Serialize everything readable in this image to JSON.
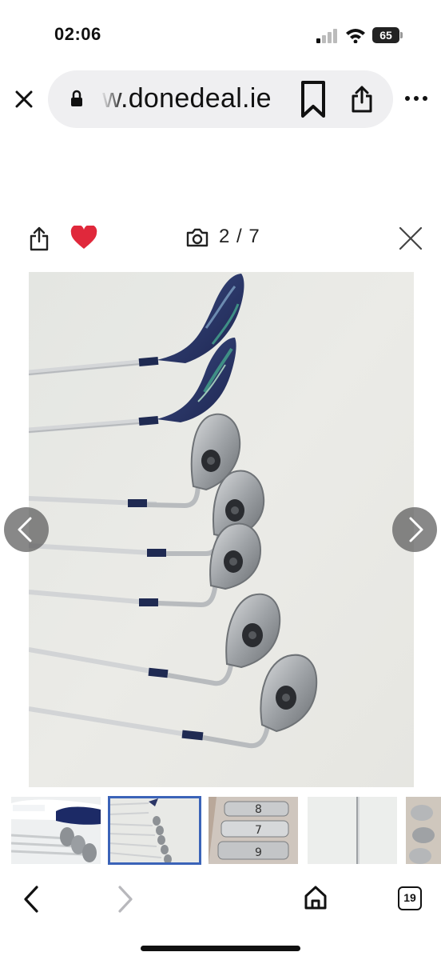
{
  "status_bar": {
    "time": "02:06",
    "battery": "65"
  },
  "browser": {
    "url": "w.donedeal.ie",
    "tabs_count": "19"
  },
  "gallery": {
    "counter": "2 / 7",
    "current_index": 2,
    "total": 7,
    "favorited": true,
    "heart_color": "#e0283b",
    "selected_thumb_border": "#3b63b8"
  },
  "icons": {
    "close_tab": "close-icon",
    "lock": "lock-icon",
    "bookmark": "bookmark-icon",
    "share": "share-icon",
    "more": "more-icon",
    "heart": "heart-icon",
    "camera": "camera-icon",
    "close_gallery": "close-icon",
    "prev": "chevron-left-icon",
    "next": "chevron-right-icon",
    "back": "back-icon",
    "forward": "forward-icon",
    "home": "home-icon",
    "tabs": "tabs-icon"
  }
}
